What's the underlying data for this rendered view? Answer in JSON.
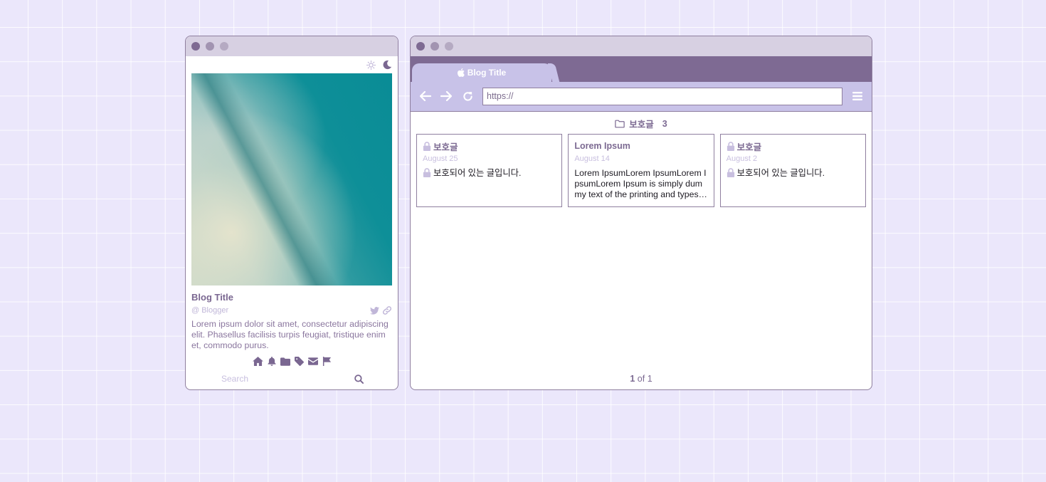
{
  "colors": {
    "accent": "#7e6a93",
    "accent_light": "#c8c2e8",
    "muted_text": "#c0b6d8",
    "background": "#ebe7fb"
  },
  "profile": {
    "theme_icons": [
      "sun-icon",
      "moon-icon"
    ],
    "blog_title": "Blog Title",
    "blogger": "@ Blogger",
    "social_icons": [
      "twitter-icon",
      "link-icon"
    ],
    "description": "Lorem ipsum dolor sit amet, consectetur adipiscing elit. Phasellus facilisis turpis feugiat, tristique enim et, commodo purus.",
    "nav_icons": [
      "home-icon",
      "bell-icon",
      "folder-icon",
      "tag-icon",
      "mail-icon",
      "flag-icon"
    ],
    "search": {
      "placeholder": "Search",
      "value": ""
    }
  },
  "browser": {
    "tab": {
      "label": "Blog Title",
      "icon": "apple-icon"
    },
    "toolbar": {
      "icons": [
        "back-arrow-icon",
        "forward-arrow-icon",
        "refresh-icon",
        "menu-icon"
      ]
    },
    "url": "https://",
    "category": {
      "name": "보호글",
      "count": "3",
      "icon": "folder-outline-icon"
    },
    "posts": [
      {
        "title": "보호글",
        "locked": true,
        "date": "August 25",
        "excerpt": "보호되어 있는 글입니다."
      },
      {
        "title": "Lorem Ipsum",
        "locked": false,
        "date": "August 14",
        "excerpt": "Lorem IpsumLorem IpsumLorem IpsumLorem Ipsum is simply dummy text of the printing and typesetting industry."
      },
      {
        "title": "보호글",
        "locked": true,
        "date": "August 2",
        "excerpt": "보호되어 있는 글입니다."
      }
    ],
    "pagination": {
      "current": "1",
      "of_label": "of",
      "total": "1"
    }
  }
}
